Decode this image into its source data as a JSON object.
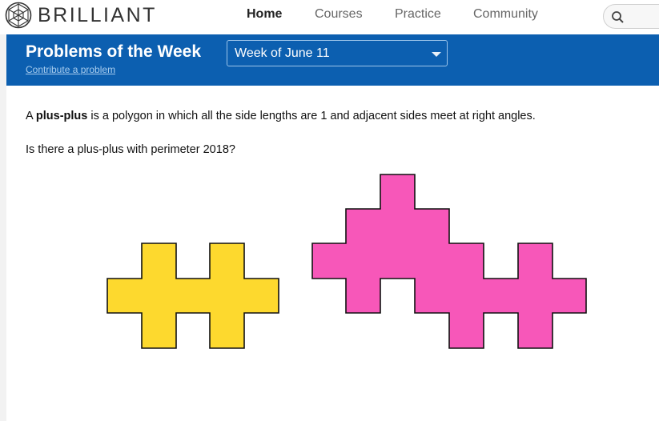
{
  "header": {
    "logo_text": "BRILLIANT",
    "nav": [
      {
        "label": "Home",
        "active": true
      },
      {
        "label": "Courses",
        "active": false
      },
      {
        "label": "Practice",
        "active": false
      },
      {
        "label": "Community",
        "active": false
      }
    ],
    "search": {
      "placeholder": "",
      "icon": "search-icon"
    }
  },
  "hero": {
    "title": "Problems of the Week",
    "link": "Contribute a problem",
    "week_select": {
      "selected": "Week of June 11"
    }
  },
  "problem": {
    "line1_prefix": "A ",
    "line1_bold": "plus-plus",
    "line1_suffix": " is a polygon in which all the side lengths are 1 and adjacent sides meet at right angles.",
    "question": "Is there a plus-plus with perimeter 2018?"
  },
  "colors": {
    "brand_blue": "#0c5fb0",
    "shape_yellow": "#fdd92e",
    "shape_pink": "#f757b9"
  }
}
